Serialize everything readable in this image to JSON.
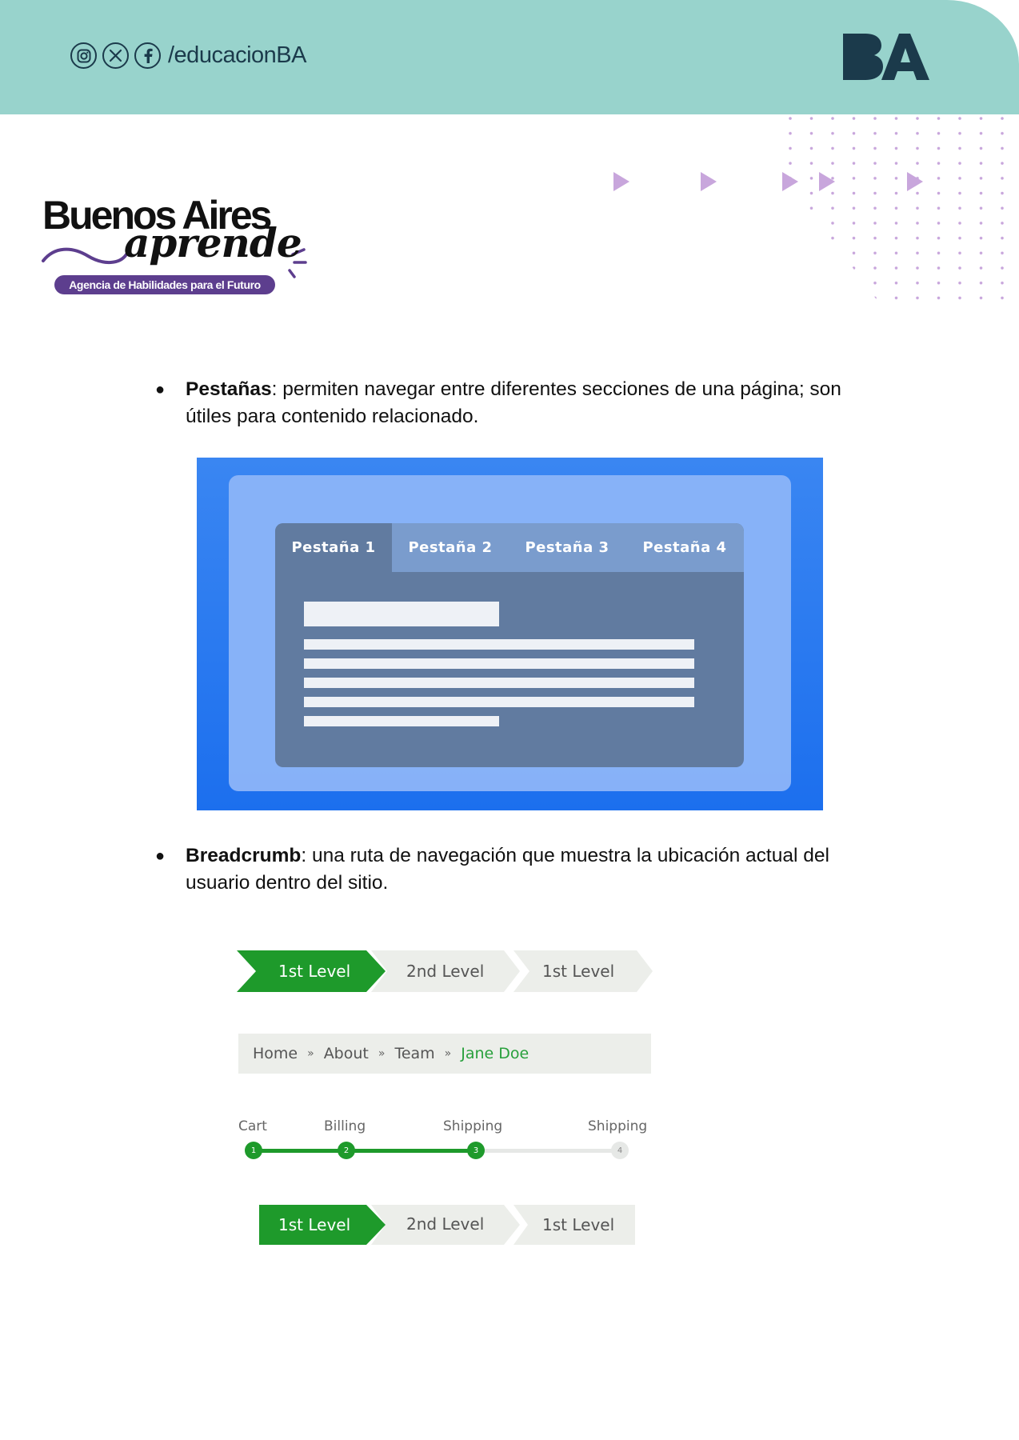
{
  "header": {
    "social_handle": "/educacionBA",
    "social_icons": [
      "instagram-icon",
      "x-icon",
      "facebook-icon"
    ],
    "brand_logo_text": "BA",
    "background_color": "#98d3cc",
    "text_color": "#1b3a4b"
  },
  "logo": {
    "title": "Buenos Aires",
    "script": "aprende",
    "tagline": "Agencia de Habilidades para el Futuro",
    "tagline_color": "#5d3e8e"
  },
  "sections": [
    {
      "term": "Pestañas",
      "description": ": permiten navegar entre diferentes secciones de una página; son útiles para contenido relacionado."
    },
    {
      "term": "Breadcrumb",
      "description": ": una ruta de navegación que muestra la ubicación actual del usuario dentro del sitio."
    }
  ],
  "tabs_example": {
    "tabs": [
      "Pestaña 1",
      "Pestaña 2",
      "Pestaña 3",
      "Pestaña 4"
    ],
    "active_index": 0
  },
  "breadcrumb_example": {
    "chevron_row_1": [
      "1st Level",
      "2nd Level",
      "1st Level"
    ],
    "trail": {
      "items": [
        "Home",
        "About",
        "Team"
      ],
      "separator": "»",
      "current": "Jane Doe"
    },
    "steps": {
      "labels": [
        "Cart",
        "Billing",
        "Shipping",
        "Shipping"
      ],
      "numbers": [
        "1",
        "2",
        "3",
        "4"
      ],
      "completed": 3
    },
    "chevron_row_2": [
      "1st Level",
      "2nd Level",
      "1st Level"
    ],
    "accent_color": "#1e9a2b"
  }
}
